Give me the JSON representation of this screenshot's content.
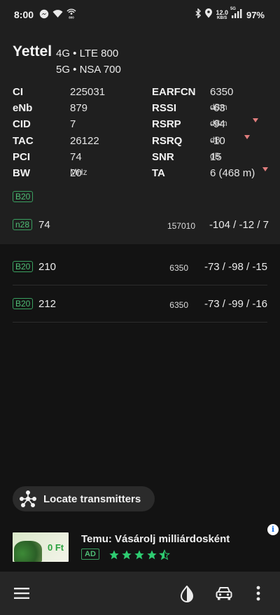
{
  "status_bar": {
    "time": "8:00",
    "net_speed_value": "12.0",
    "net_speed_unit": "KB/S",
    "network_type": "5G",
    "battery": "97%",
    "icons": [
      "messenger-icon",
      "wifi-icon",
      "hotspot-icon",
      "bluetooth-icon",
      "location-icon",
      "signal-icon"
    ]
  },
  "serving_cell": {
    "operator": "Yettel",
    "tech_line1": "4G • LTE 800",
    "tech_line2": "5G • NSA 700",
    "left": [
      {
        "label": "CI",
        "value": "225031"
      },
      {
        "label": "eNb",
        "value": "879"
      },
      {
        "label": "CID",
        "value": "7"
      },
      {
        "label": "TAC",
        "value": "26122"
      },
      {
        "label": "PCI",
        "value": "74"
      },
      {
        "label": "BW",
        "value": "20",
        "unit": "MHz"
      }
    ],
    "right": [
      {
        "label": "EARFCN",
        "value": "6350",
        "unit": ""
      },
      {
        "label": "RSSI",
        "value": "-63",
        "unit": "dBm"
      },
      {
        "label": "RSRP",
        "value": "-94",
        "unit": "dBm"
      },
      {
        "label": "RSRQ",
        "value": "-10",
        "unit": "dB"
      },
      {
        "label": "SNR",
        "value": "15",
        "unit": "dB"
      },
      {
        "label": "TA",
        "value": "6 (468 m)",
        "unit": ""
      }
    ],
    "band": "B20",
    "nr_cell": {
      "band": "n28",
      "pci": "74",
      "arfcn": "157010",
      "values": "-104 / -12 / 7"
    }
  },
  "neighbors": [
    {
      "band": "B20",
      "pci": "210",
      "arfcn": "6350",
      "values": "-73 / -98 / -15"
    },
    {
      "band": "B20",
      "pci": "212",
      "arfcn": "6350",
      "values": "-73 / -99 / -16"
    }
  ],
  "locate_button": {
    "label": "Locate transmitters"
  },
  "ad": {
    "title": "Temu: Vásárolj milliárdosként",
    "badge": "AD",
    "rating": 4.5,
    "thumb_text": "0 Ft",
    "info_glyph": "i"
  },
  "colors": {
    "accent_green": "#4fbd75",
    "trend_red": "#e07d7d",
    "panel_bg": "#1f1f1f",
    "page_bg": "#131313"
  }
}
